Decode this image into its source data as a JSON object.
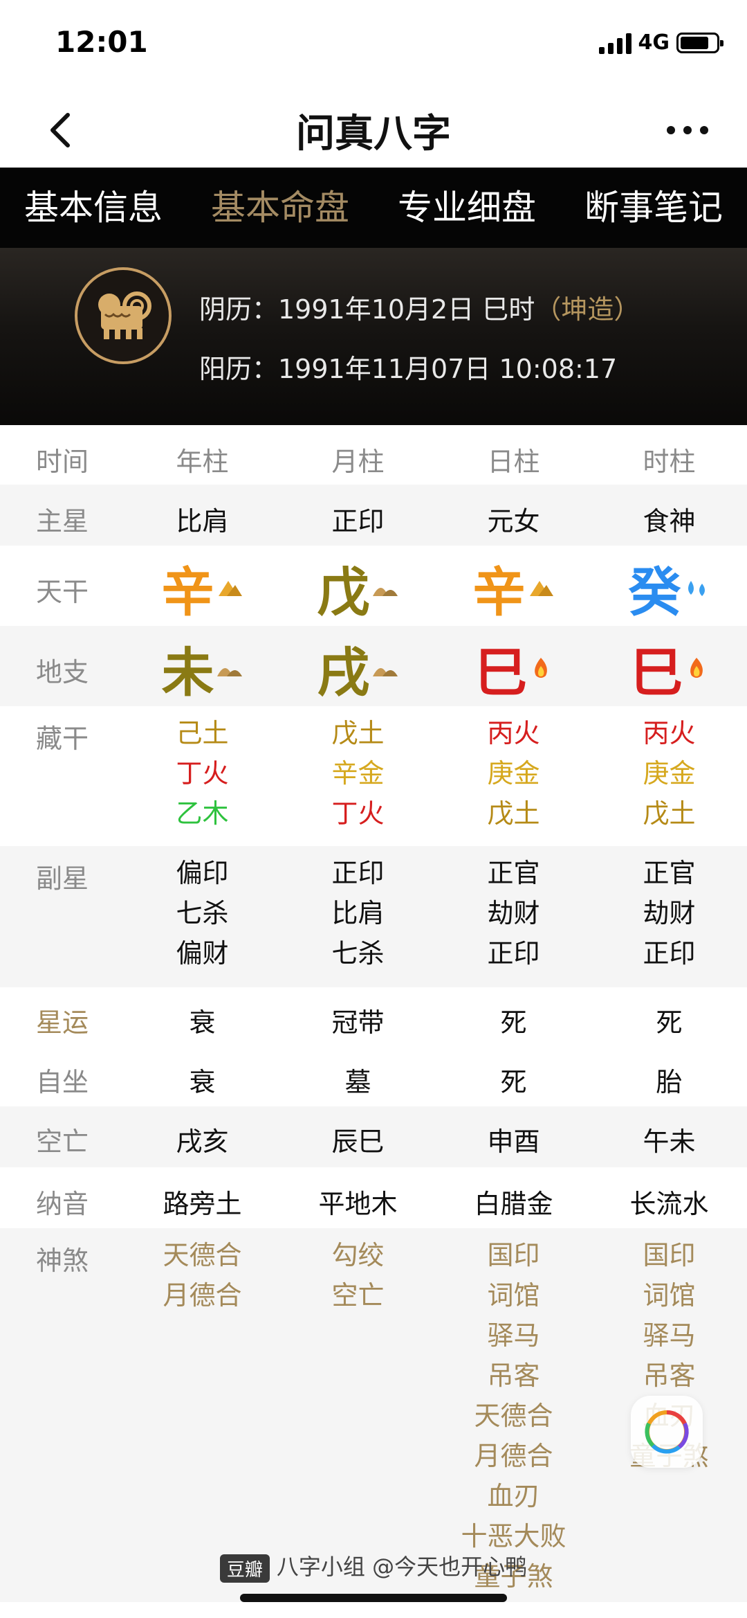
{
  "status": {
    "time": "12:01",
    "network": "4G"
  },
  "nav": {
    "title": "问真八字"
  },
  "tabs": [
    "基本信息",
    "基本命盘",
    "专业细盘",
    "断事笔记"
  ],
  "header": {
    "lunar_label": "阴历：1991年10月2日 巳时",
    "lunar_tag": "（坤造）",
    "solar_label": "阳历：1991年11月07日 10:08:17"
  },
  "grid": {
    "header": [
      "时间",
      "年柱",
      "月柱",
      "日柱",
      "时柱"
    ],
    "main_star": {
      "label": "主星",
      "values": [
        "比肩",
        "正印",
        "元女",
        "食神"
      ]
    },
    "tiangan": {
      "label": "天干",
      "values": [
        "辛",
        "戊",
        "辛",
        "癸"
      ]
    },
    "dizhi": {
      "label": "地支",
      "values": [
        "未",
        "戌",
        "巳",
        "巳"
      ]
    },
    "canggan": {
      "label": "藏干",
      "values": [
        [
          "己土",
          "丁火",
          "乙木"
        ],
        [
          "戊土",
          "辛金",
          "丁火"
        ],
        [
          "丙火",
          "庚金",
          "戊土"
        ],
        [
          "丙火",
          "庚金",
          "戊土"
        ]
      ]
    },
    "fuxing": {
      "label": "副星",
      "values": [
        [
          "偏印",
          "七杀",
          "偏财"
        ],
        [
          "正印",
          "比肩",
          "七杀"
        ],
        [
          "正官",
          "劫财",
          "正印"
        ],
        [
          "正官",
          "劫财",
          "正印"
        ]
      ]
    },
    "xingyun": {
      "label": "星运",
      "values": [
        "衰",
        "冠带",
        "死",
        "死"
      ]
    },
    "zizuo": {
      "label": "自坐",
      "values": [
        "衰",
        "墓",
        "死",
        "胎"
      ]
    },
    "kongwang": {
      "label": "空亡",
      "values": [
        "戌亥",
        "辰巳",
        "申酉",
        "午未"
      ]
    },
    "nayin": {
      "label": "纳音",
      "values": [
        "路旁土",
        "平地木",
        "白腊金",
        "长流水"
      ]
    },
    "shensha": {
      "label": "神煞",
      "values": [
        [
          "天德合",
          "月德合"
        ],
        [
          "勾绞",
          "空亡"
        ],
        [
          "国印",
          "词馆",
          "驿马",
          "吊客",
          "天德合",
          "月德合",
          "血刃",
          "十恶大败",
          "童子煞"
        ],
        [
          "国印",
          "词馆",
          "驿马",
          "吊客",
          "血刃",
          "童子煞"
        ]
      ]
    }
  },
  "watermark": {
    "badge": "豆瓣",
    "text": "八字小组 @今天也开心鸭"
  }
}
